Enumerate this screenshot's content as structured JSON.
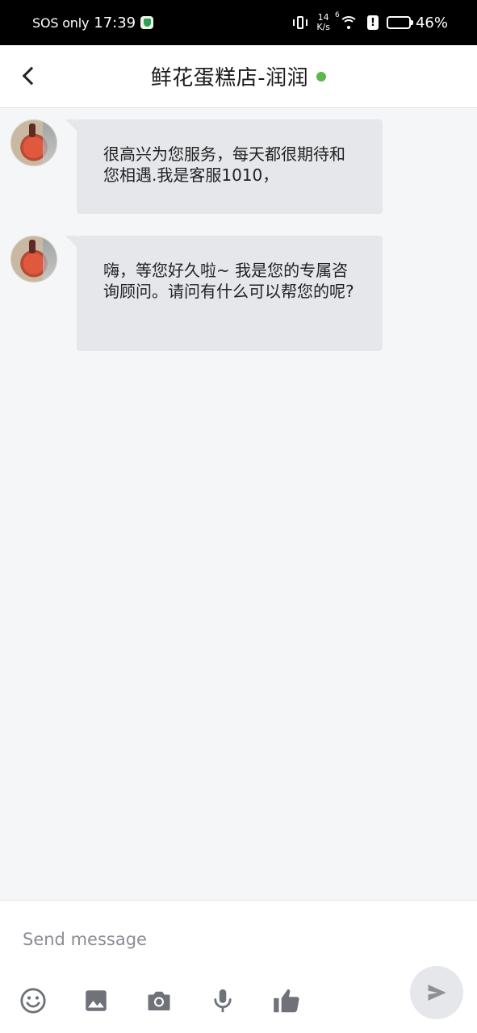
{
  "status_bar": {
    "carrier": "SOS only",
    "time": "17:39",
    "net_speed_value": "14",
    "net_speed_unit": "K/s",
    "wifi_badge": "6",
    "alert_glyph": "!",
    "battery_percent": "46%"
  },
  "header": {
    "title": "鲜花蛋糕店-润润",
    "online_color": "#5bb84a"
  },
  "messages": [
    {
      "sender": "agent",
      "text": "很高兴为您服务，每天都很期待和您相遇.我是客服1010，"
    },
    {
      "sender": "agent",
      "text": "嗨，等您好久啦~ 我是您的专属咨询顾问。请问有什么可以帮您的呢?"
    }
  ],
  "composer": {
    "placeholder": "Send message",
    "tools": [
      "emoji-icon",
      "image-icon",
      "camera-icon",
      "microphone-icon",
      "thumbs-up-icon"
    ]
  },
  "colors": {
    "background": "#f5f6f8",
    "bubble": "#e6e7eb",
    "icon": "#6f7278"
  }
}
